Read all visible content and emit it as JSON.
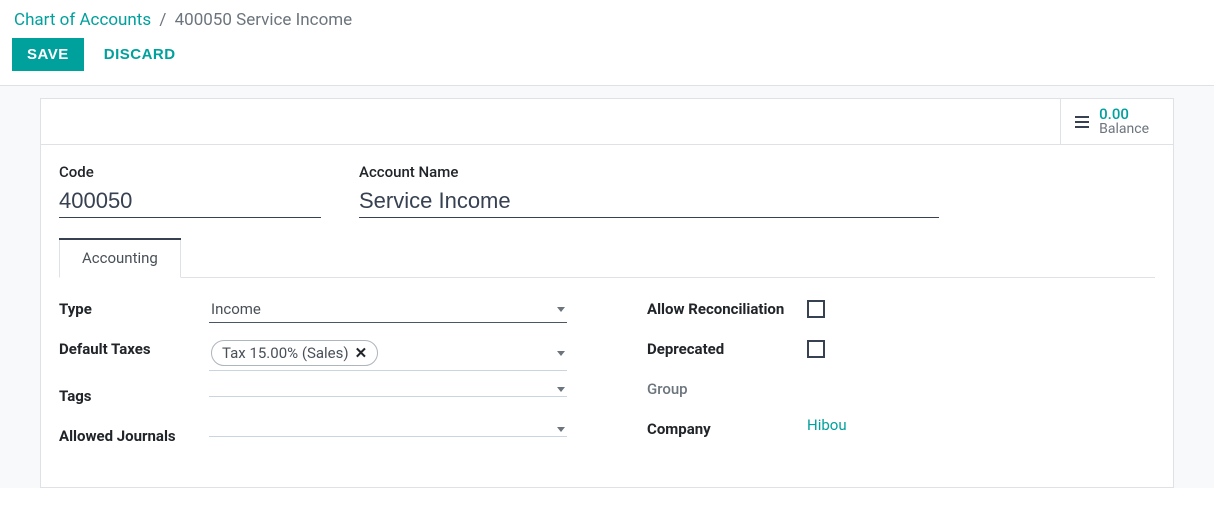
{
  "breadcrumb": {
    "parent": "Chart of Accounts",
    "sep": "/",
    "current": "400050 Service Income"
  },
  "actions": {
    "save": "SAVE",
    "discard": "DISCARD"
  },
  "stat": {
    "value": "0.00",
    "label": "Balance"
  },
  "head": {
    "code_label": "Code",
    "code_value": "400050",
    "name_label": "Account Name",
    "name_value": "Service Income"
  },
  "tabs": {
    "accounting": "Accounting"
  },
  "left": {
    "type_label": "Type",
    "type_value": "Income",
    "taxes_label": "Default Taxes",
    "taxes_tag": "Tax 15.00% (Sales)",
    "tags_label": "Tags",
    "journals_label": "Allowed Journals"
  },
  "right": {
    "allow_label": "Allow Reconciliation",
    "deprecated_label": "Deprecated",
    "group_label": "Group",
    "company_label": "Company",
    "company_value": "Hibou"
  }
}
